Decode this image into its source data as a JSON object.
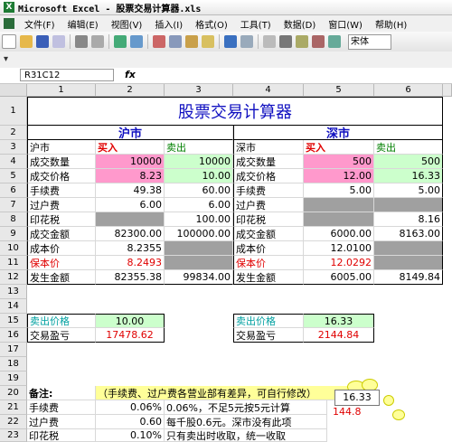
{
  "window": {
    "title": "Microsoft Excel - 股票交易计算器.xls"
  },
  "menu": [
    "文件(F)",
    "编辑(E)",
    "视图(V)",
    "插入(I)",
    "格式(O)",
    "工具(T)",
    "数据(D)",
    "窗口(W)",
    "帮助(H)"
  ],
  "toolbar": {
    "font_name": "宋体",
    "fx_label": "fx"
  },
  "name_box": "R31C12",
  "columns": [
    "1",
    "2",
    "3",
    "4",
    "5",
    "6"
  ],
  "rows": [
    "1",
    "2",
    "3",
    "4",
    "5",
    "6",
    "7",
    "8",
    "9",
    "10",
    "11",
    "12",
    "13",
    "14",
    "15",
    "16",
    "17",
    "18",
    "19",
    "20",
    "21",
    "22",
    "23"
  ],
  "sheet": {
    "title": "股票交易计算器",
    "sh": {
      "header": "沪市",
      "label": "沪市",
      "buy": "买入",
      "sell": "卖出"
    },
    "sz": {
      "header": "深市",
      "label": "深市",
      "buy": "买入",
      "sell": "卖出"
    },
    "labels": [
      "成交数量",
      "成交价格",
      "手续费",
      "过户费",
      "印花税",
      "成交金额",
      "成本价",
      "保本价",
      "发生金额"
    ],
    "sh_buy": [
      "10000",
      "8.23",
      "49.38",
      "6.00",
      "",
      "82300.00",
      "8.2355",
      "8.2493",
      "82355.38"
    ],
    "sh_sell": [
      "10000",
      "10.00",
      "60.00",
      "6.00",
      "100.00",
      "100000.00",
      "",
      "",
      "99834.00"
    ],
    "sz_buy": [
      "500",
      "12.00",
      "5.00",
      "",
      "",
      "6000.00",
      "12.0100",
      "12.0292",
      "6005.00"
    ],
    "sz_sell": [
      "500",
      "16.33",
      "5.00",
      "",
      "8.16",
      "8163.00",
      "",
      "",
      "8149.84"
    ],
    "sell_price_label": "卖出价格",
    "profit_label": "交易盈亏",
    "sh_sell_price": "10.00",
    "sh_profit": "17478.62",
    "sz_sell_price": "16.33",
    "sz_profit": "2144.84",
    "remarks_label": "备注:",
    "remarks_note": "（手续费、过户费各营业部有差异，可自行修改）",
    "fee_rows": [
      {
        "label": "手续费",
        "rate": "0.06%",
        "desc": "0.06%，不足5元按5元计算"
      },
      {
        "label": "过户费",
        "rate": "0.60",
        "desc": "每千股0.6元。深市没有此项"
      },
      {
        "label": "印花税",
        "rate": "0.10%",
        "desc": "只有卖出时收取，统一收取"
      }
    ],
    "overlay": {
      "value1": "16.33",
      "value2": "144.8"
    }
  },
  "colors": {
    "pink": "#ff99cc",
    "gray": "#a0a0a0",
    "green": "#ccffcc",
    "title_blue": "#1010c0",
    "red": "#e00000"
  }
}
